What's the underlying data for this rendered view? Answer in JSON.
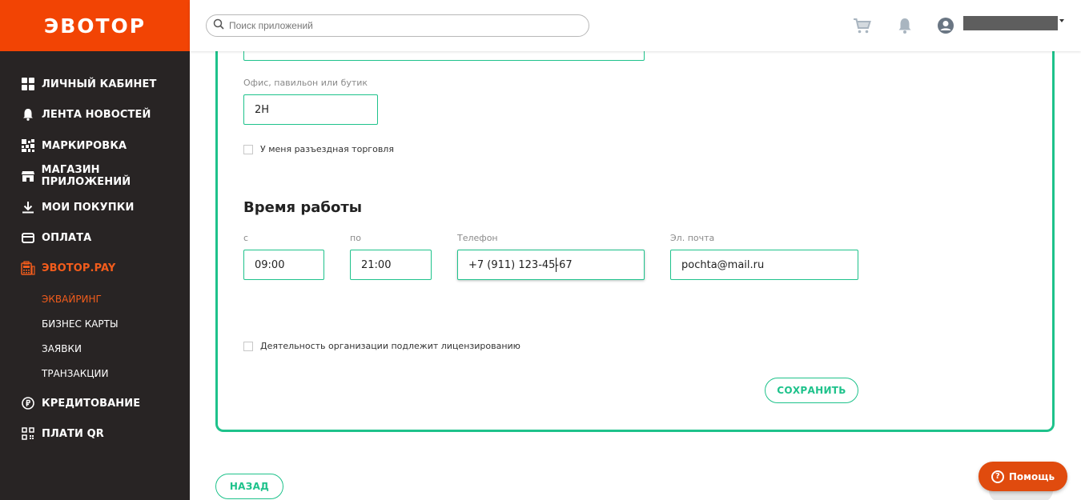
{
  "brand": {
    "logo_text": "ЭВОТОР",
    "accent": "#f24404",
    "green": "#1ec28b"
  },
  "header": {
    "search_placeholder": "Поиск приложений",
    "icons": [
      "cart-icon",
      "bell-icon",
      "user-icon"
    ]
  },
  "sidebar": {
    "items": [
      {
        "label": "ЛИЧНЫЙ КАБИНЕТ",
        "icon": "dashboard-icon"
      },
      {
        "label": "ЛЕНТА НОВОСТЕЙ",
        "icon": "bell-icon"
      },
      {
        "label": "МАРКИРОВКА",
        "icon": "marking-icon"
      },
      {
        "label": "МАГАЗИН ПРИЛОЖЕНИЙ",
        "icon": "store-icon"
      },
      {
        "label": "МОИ ПОКУПКИ",
        "icon": "download-icon"
      },
      {
        "label": "ОПЛАТА",
        "icon": "card-icon"
      },
      {
        "label": "ЭВОТОР.PAY",
        "icon": "pay-terminal-icon",
        "active": true
      },
      {
        "label": "КРЕДИТОВАНИЕ",
        "icon": "ruble-icon"
      },
      {
        "label": "ПЛАТИ QR",
        "icon": "qr-icon"
      }
    ],
    "sub_items": [
      {
        "label": "ЭКВАЙРИНГ",
        "active": true
      },
      {
        "label": "БИЗНЕС КАРТЫ"
      },
      {
        "label": "ЗАЯВКИ"
      },
      {
        "label": "ТРАНЗАКЦИИ"
      }
    ]
  },
  "form": {
    "office_label": "Офис, павильон или бутик",
    "office_value": "2Н",
    "mobile_trade_label": "У меня разъездная торговля",
    "section_title": "Время работы",
    "from_label": "с",
    "from_value": "09:00",
    "to_label": "по",
    "to_value": "21:00",
    "phone_label": "Телефон",
    "phone_value": "+7 (911) 123-45-67",
    "email_label": "Эл. почта",
    "email_value": "pochta@mail.ru",
    "license_label": "Деятельность организации подлежит лицензированию",
    "save_label": "СОХРАНИТЬ"
  },
  "footer": {
    "back_label": "НАЗАД",
    "help_label": "Помощь"
  }
}
